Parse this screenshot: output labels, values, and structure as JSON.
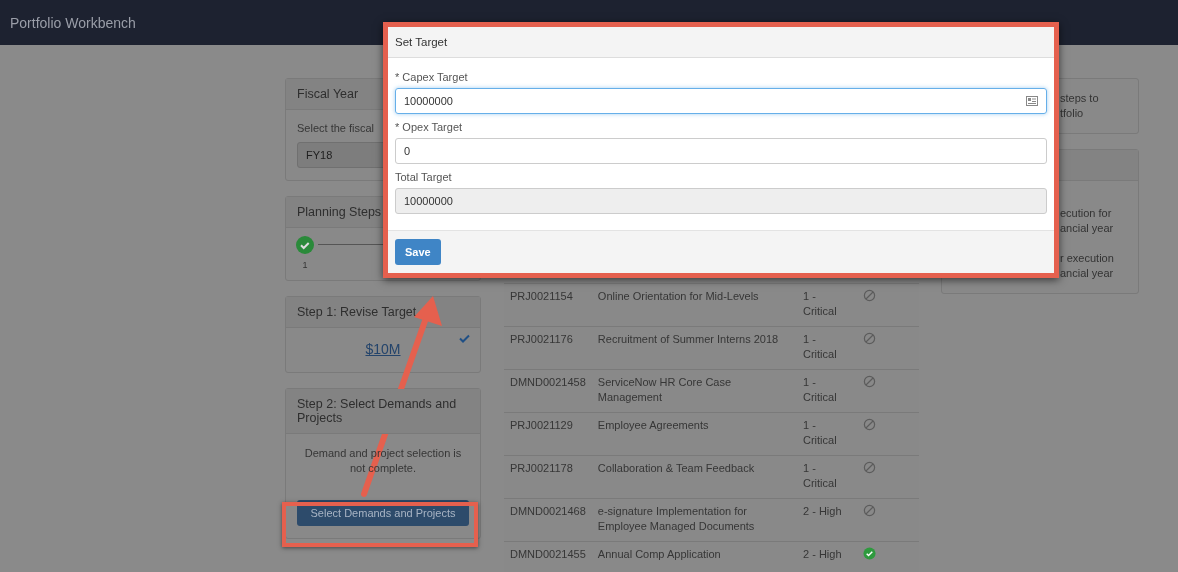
{
  "header": {
    "title": "Portfolio Workbench"
  },
  "fiscal_year": {
    "title": "Fiscal Year",
    "prompt": "Select the fiscal",
    "value": "FY18"
  },
  "planning_steps": {
    "title": "Planning Steps",
    "steps": [
      {
        "label": "1",
        "done": true
      }
    ]
  },
  "step1": {
    "title": "Step 1: Revise Target",
    "target": "$10M",
    "complete": true
  },
  "step2": {
    "title": "Step 2: Select Demands and Projects",
    "message": "Demand and project selection is not complete.",
    "button": "Select Demands and Projects"
  },
  "table": {
    "rows": [
      {
        "number": "PRJ0021154",
        "name": "Online Orientation for Mid-Levels",
        "priority": "1 - Critical",
        "complete": false
      },
      {
        "number": "PRJ0021176",
        "name": "Recruitment of Summer Interns 2018",
        "priority": "1 - Critical",
        "complete": false
      },
      {
        "number": "DMND0021458",
        "name": "ServiceNow HR Core Case Management",
        "priority": "1 - Critical",
        "complete": false
      },
      {
        "number": "PRJ0021129",
        "name": "Employee Agreements",
        "priority": "1 - Critical",
        "complete": false
      },
      {
        "number": "PRJ0021178",
        "name": "Collaboration & Team Feedback",
        "priority": "1 - Critical",
        "complete": false
      },
      {
        "number": "DMND0021468",
        "name": "e-signature Implementation for Employee Managed Documents",
        "priority": "2 - High",
        "complete": false
      },
      {
        "number": "DMND0021455",
        "name": "Annual Comp Application",
        "priority": "2 - High",
        "complete": true
      }
    ]
  },
  "right_panels": [
    {
      "has_header": false,
      "lines": [
        "steps to",
        "tfolio"
      ]
    },
    {
      "has_header": true,
      "lines": [
        "ecution for",
        "ancial year",
        "r execution",
        "ancial year"
      ]
    }
  ],
  "modal": {
    "title": "Set Target",
    "fields": [
      {
        "label": "* Capex Target",
        "value": "10000000",
        "focused": true,
        "readonly": false
      },
      {
        "label": "* Opex Target",
        "value": "0",
        "focused": false,
        "readonly": false
      },
      {
        "label": "Total Target",
        "value": "10000000",
        "focused": false,
        "readonly": true
      }
    ],
    "save": "Save"
  }
}
